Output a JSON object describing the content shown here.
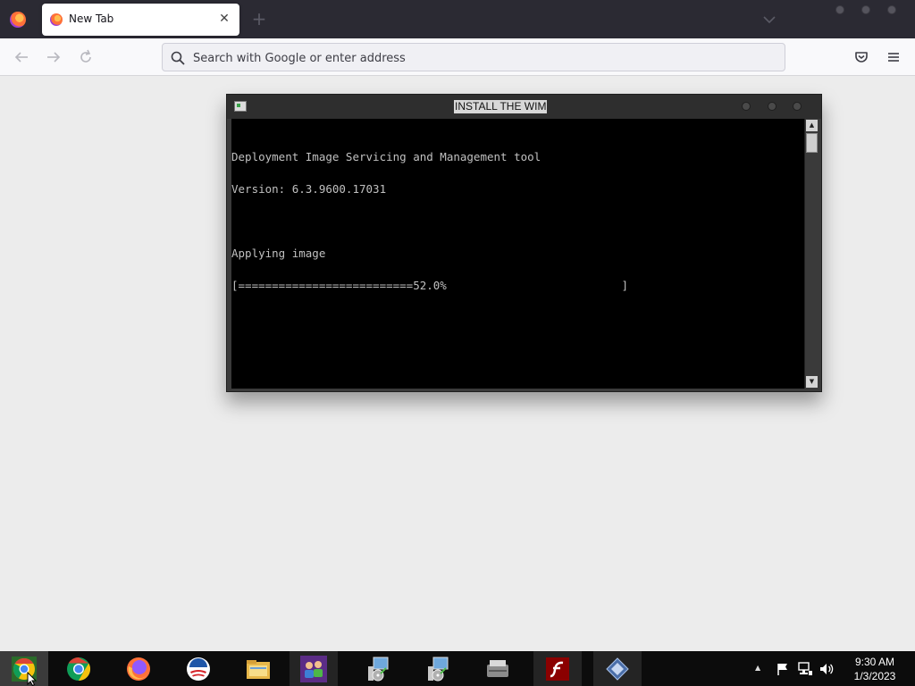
{
  "browser": {
    "tab": {
      "title": "New Tab",
      "close_symbol": "✕"
    },
    "new_tab_symbol": "+",
    "urlbar": {
      "placeholder": "Search with Google or enter address",
      "value": ""
    },
    "icons": [
      "firefox-icon",
      "back-arrow-icon",
      "forward-arrow-icon",
      "reload-icon",
      "search-icon",
      "pocket-icon",
      "hamburger-menu-icon",
      "chevron-down-icon"
    ]
  },
  "console": {
    "title": "INSTALL THE WIM",
    "lines": [
      "Deployment Image Servicing and Management tool",
      "Version: 6.3.9600.17031",
      "",
      "Applying image",
      "[==========================52.0%                          ]"
    ],
    "progress_percent": 52.0,
    "scroll_up_symbol": "▲",
    "scroll_down_symbol": "▼"
  },
  "taskbar": {
    "apps": [
      {
        "name": "chrome-canary",
        "label": "Google Chrome"
      },
      {
        "name": "chrome",
        "label": "Google Chrome"
      },
      {
        "name": "firefox",
        "label": "Firefox"
      },
      {
        "name": "obama-logo",
        "label": "App"
      },
      {
        "name": "file-explorer",
        "label": "File Explorer"
      },
      {
        "name": "people",
        "label": "People"
      },
      {
        "name": "setup-installer-1",
        "label": "Setup"
      },
      {
        "name": "setup-installer-2",
        "label": "Setup"
      },
      {
        "name": "scanner",
        "label": "Scanner"
      },
      {
        "name": "flash-player",
        "label": "Flash Player"
      },
      {
        "name": "vs-installer",
        "label": "Installer"
      }
    ],
    "tray": {
      "show_hidden_symbol": "▲",
      "time": "9:30 AM",
      "date": "1/3/2023"
    }
  },
  "colors": {
    "tabstrip_bg": "#2b2a33",
    "console_bg": "#000000",
    "console_text": "#c0c0c0",
    "taskbar_bg": "#0c0c0c",
    "page_bg": "#ececec"
  }
}
